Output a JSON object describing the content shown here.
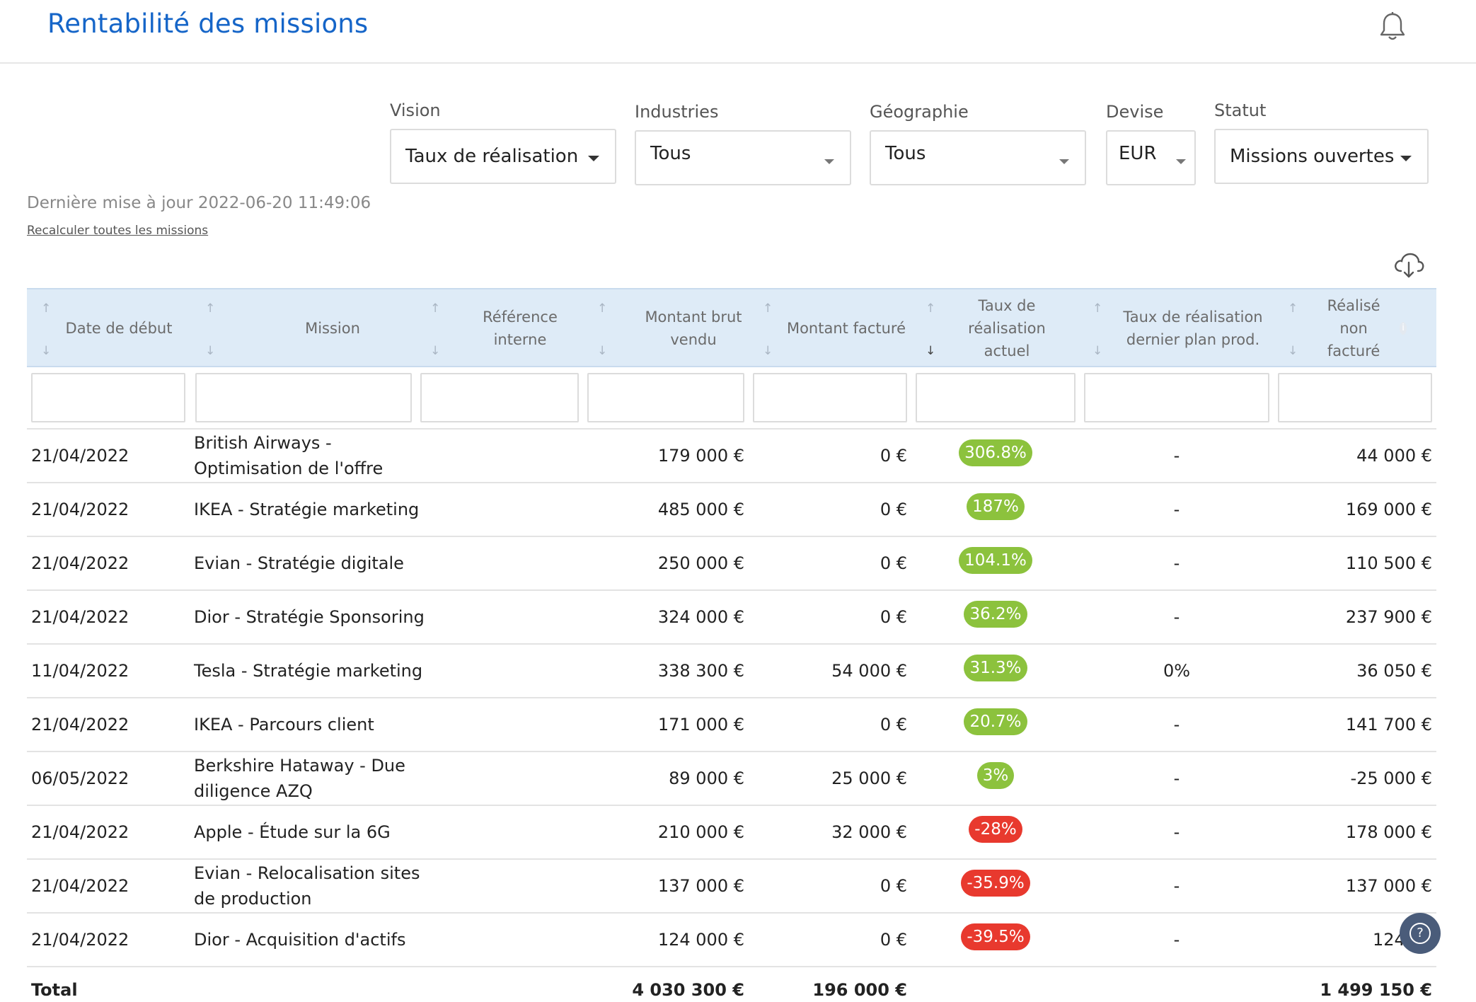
{
  "header": {
    "title": "Rentabilité des missions",
    "notification_icon": "bell-icon"
  },
  "filters": {
    "vision": {
      "label": "Vision",
      "value": "Taux de réalisation"
    },
    "industries": {
      "label": "Industries",
      "value": "Tous"
    },
    "geographie": {
      "label": "Géographie",
      "value": "Tous"
    },
    "devise": {
      "label": "Devise",
      "value": "EUR"
    },
    "statut": {
      "label": "Statut",
      "value": "Missions ouvertes"
    }
  },
  "meta": {
    "last_update": "Dernière mise à jour 2022-06-20 11:49:06",
    "recalc_link": "Recalculer toutes les missions",
    "download_icon": "cloud-download-icon"
  },
  "table": {
    "columns": [
      {
        "key": "date",
        "label": "Date de début"
      },
      {
        "key": "mission",
        "label": "Mission"
      },
      {
        "key": "ref",
        "label": "Référence interne"
      },
      {
        "key": "brut",
        "label": "Montant brut vendu"
      },
      {
        "key": "facture",
        "label": "Montant facturé"
      },
      {
        "key": "taux_actuel",
        "label": "Taux de réalisation actuel"
      },
      {
        "key": "taux_plan",
        "label": "Taux de réalisation dernier plan prod."
      },
      {
        "key": "non_facture",
        "label": "Réalisé non facturé"
      }
    ],
    "sorted_column": "taux_actuel",
    "sort_direction": "desc",
    "rows": [
      {
        "date": "21/04/2022",
        "mission": "British Airways - Optimisation de l'offre",
        "ref": "",
        "brut": "179 000 €",
        "facture": "0 €",
        "taux_actuel": "306.8%",
        "status": "positive",
        "taux_plan": "-",
        "non_facture": "44 000 €"
      },
      {
        "date": "21/04/2022",
        "mission": "IKEA - Stratégie marketing",
        "ref": "",
        "brut": "485 000 €",
        "facture": "0 €",
        "taux_actuel": "187%",
        "status": "positive",
        "taux_plan": "-",
        "non_facture": "169 000 €"
      },
      {
        "date": "21/04/2022",
        "mission": "Evian - Stratégie digitale",
        "ref": "",
        "brut": "250 000 €",
        "facture": "0 €",
        "taux_actuel": "104.1%",
        "status": "positive",
        "taux_plan": "-",
        "non_facture": "110 500 €"
      },
      {
        "date": "21/04/2022",
        "mission": "Dior - Stratégie Sponsoring",
        "ref": "",
        "brut": "324 000 €",
        "facture": "0 €",
        "taux_actuel": "36.2%",
        "status": "positive",
        "taux_plan": "-",
        "non_facture": "237 900 €"
      },
      {
        "date": "11/04/2022",
        "mission": "Tesla - Stratégie marketing",
        "ref": "",
        "brut": "338 300 €",
        "facture": "54 000 €",
        "taux_actuel": "31.3%",
        "status": "positive",
        "taux_plan": "0%",
        "non_facture": "36 050 €"
      },
      {
        "date": "21/04/2022",
        "mission": "IKEA - Parcours client",
        "ref": "",
        "brut": "171 000 €",
        "facture": "0 €",
        "taux_actuel": "20.7%",
        "status": "positive",
        "taux_plan": "-",
        "non_facture": "141 700 €"
      },
      {
        "date": "06/05/2022",
        "mission": "Berkshire Hataway - Due diligence AZQ",
        "ref": "",
        "brut": "89 000 €",
        "facture": "25 000 €",
        "taux_actuel": "3%",
        "status": "positive",
        "taux_plan": "-",
        "non_facture": "-25 000 €"
      },
      {
        "date": "21/04/2022",
        "mission": "Apple - Étude sur la 6G",
        "ref": "",
        "brut": "210 000 €",
        "facture": "32 000 €",
        "taux_actuel": "-28%",
        "status": "negative",
        "taux_plan": "-",
        "non_facture": "178 000 €"
      },
      {
        "date": "21/04/2022",
        "mission": "Evian - Relocalisation sites de production",
        "ref": "",
        "brut": "137 000 €",
        "facture": "0 €",
        "taux_actuel": "-35.9%",
        "status": "negative",
        "taux_plan": "-",
        "non_facture": "137 000 €"
      },
      {
        "date": "21/04/2022",
        "mission": "Dior - Acquisition d'actifs",
        "ref": "",
        "brut": "124 000 €",
        "facture": "0 €",
        "taux_actuel": "-39.5%",
        "status": "negative",
        "taux_plan": "-",
        "non_facture": "124 00"
      }
    ],
    "total": {
      "label": "Total",
      "brut": "4 030 300 €",
      "facture": "196 000 €",
      "non_facture": "1 499 150 €"
    }
  },
  "help": {
    "icon": "help-icon",
    "glyph": "?"
  }
}
